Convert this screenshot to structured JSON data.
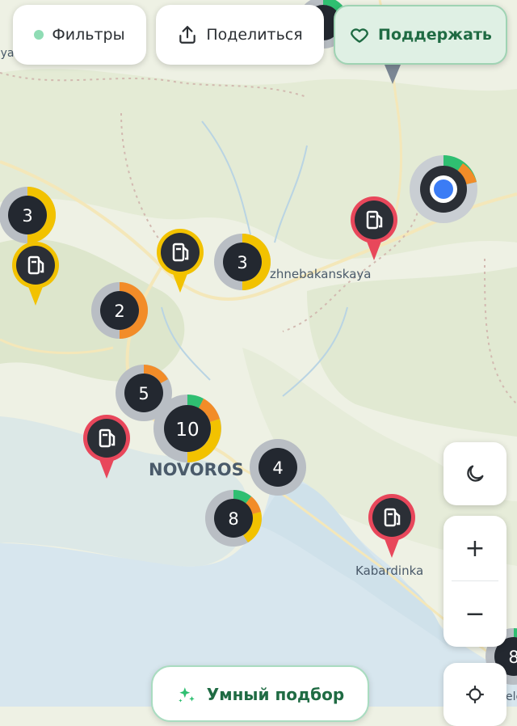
{
  "top_bar": {
    "filters_label": "Фильтры",
    "share_label": "Поделиться",
    "support_label": "Поддержать"
  },
  "map": {
    "places": {
      "nizhnebakanskaya": "zhnebakanskaya",
      "novorossiysk": "NOVOROS",
      "kabardinka": "Kabardinka",
      "left_edge": "aya",
      "right_edge": "ele"
    },
    "clusters": [
      {
        "id": "c1",
        "count": "3"
      },
      {
        "id": "c2",
        "count": "3"
      },
      {
        "id": "c3",
        "count": "2"
      },
      {
        "id": "c4",
        "count": "5"
      },
      {
        "id": "c5",
        "count": "10"
      },
      {
        "id": "c6",
        "count": "4"
      },
      {
        "id": "c7",
        "count": "8"
      },
      {
        "id": "c8",
        "count": "8"
      }
    ]
  },
  "controls": {
    "zoom_in": "+",
    "zoom_out": "−"
  },
  "smart_pick": {
    "label": "Умный подбор"
  },
  "colors": {
    "accent_green": "#1f6b43",
    "station_red": "#e8475b",
    "station_yellow": "#f2c200",
    "user_location": "#3b7cf5",
    "cluster_orange": "#f28c28"
  }
}
